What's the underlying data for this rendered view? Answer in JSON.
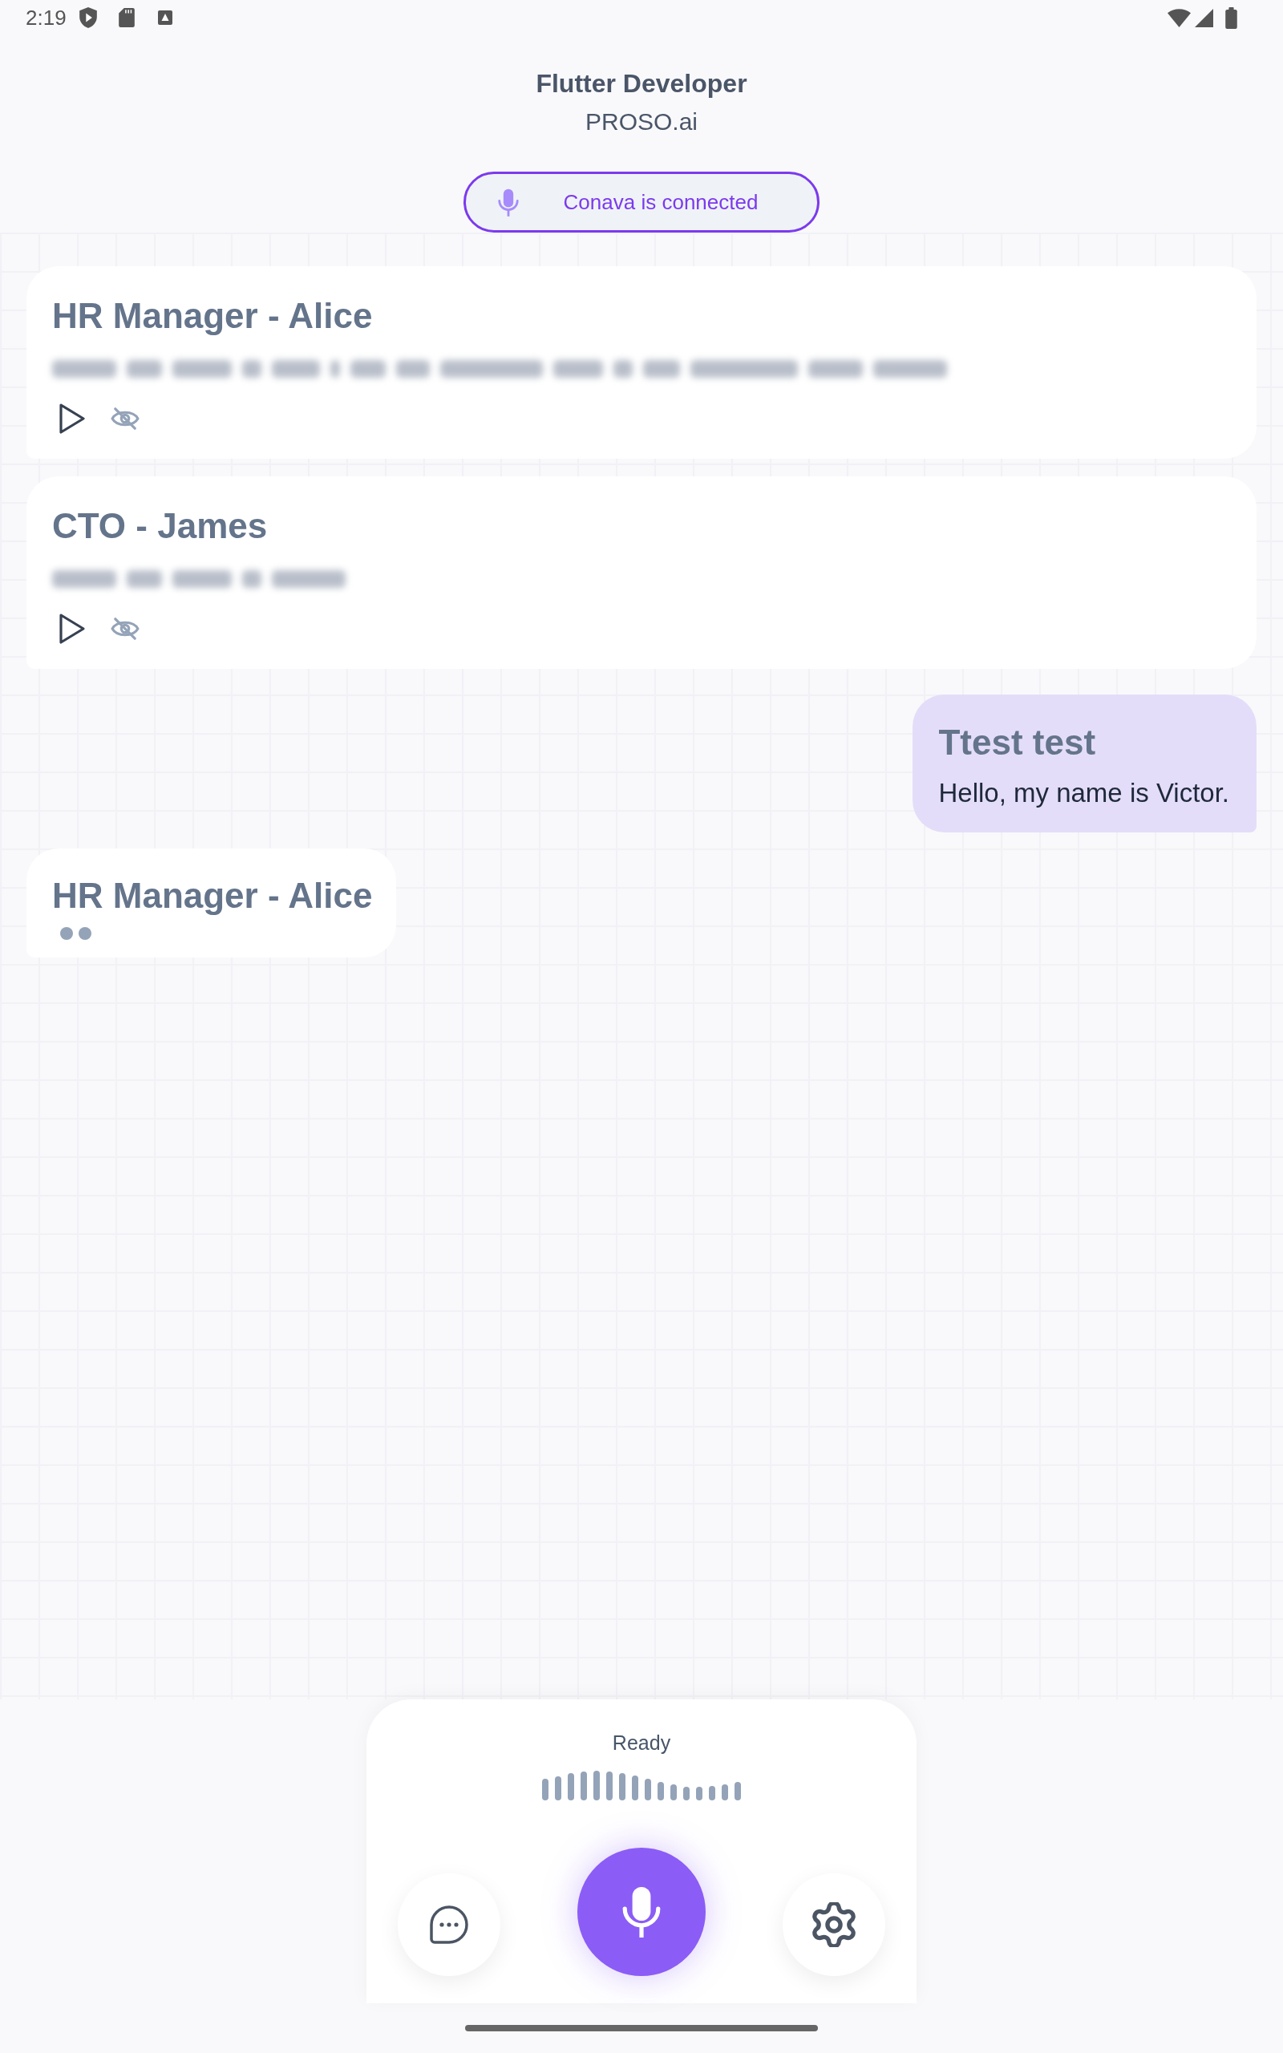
{
  "status_bar": {
    "time": "2:19"
  },
  "header": {
    "title": "Flutter Developer",
    "subtitle": "PROSO.ai"
  },
  "connection": {
    "label": "Conava is connected"
  },
  "messages": [
    {
      "kind": "agent",
      "speaker": "HR Manager - Alice",
      "text_hidden": true
    },
    {
      "kind": "agent",
      "speaker": "CTO - James",
      "text_hidden": true
    },
    {
      "kind": "user",
      "speaker": "Ttest test",
      "text": "Hello, my name is Victor."
    },
    {
      "kind": "typing",
      "speaker": "HR Manager - Alice"
    }
  ],
  "voice_panel": {
    "status": "Ready"
  }
}
